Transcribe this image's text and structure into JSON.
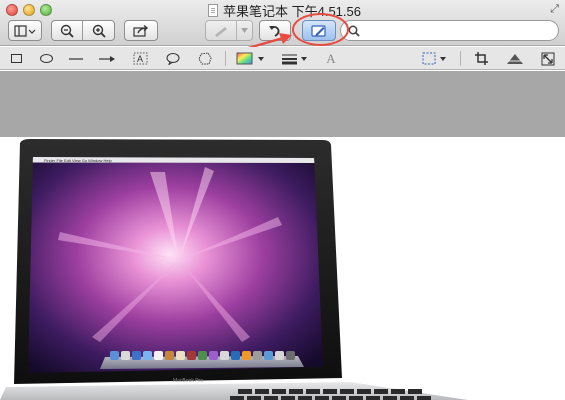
{
  "window": {
    "title": "苹果笔记本 下午4.51.56"
  },
  "toolbar": {
    "icons": [
      "sidebar-toggle-icon",
      "zoom-out-icon",
      "zoom-in-icon",
      "share-icon",
      "markup-pen-icon",
      "rotate-icon",
      "edit-toolbar-icon",
      "search-icon"
    ]
  },
  "search": {
    "value": "",
    "placeholder": ""
  },
  "edit_toolbar": {
    "tools": [
      "rectangle",
      "oval",
      "line",
      "arrow",
      "text",
      "speech-bubble",
      "freeform",
      "color",
      "line-width",
      "font"
    ],
    "right_tools": [
      "rect-select",
      "crop",
      "adjust-color",
      "adjust-size"
    ]
  },
  "image": {
    "laptop_label": "MacBook Pro"
  },
  "colors": {
    "annotation": "#e74b41",
    "gray_band": "#a7a7a7"
  }
}
